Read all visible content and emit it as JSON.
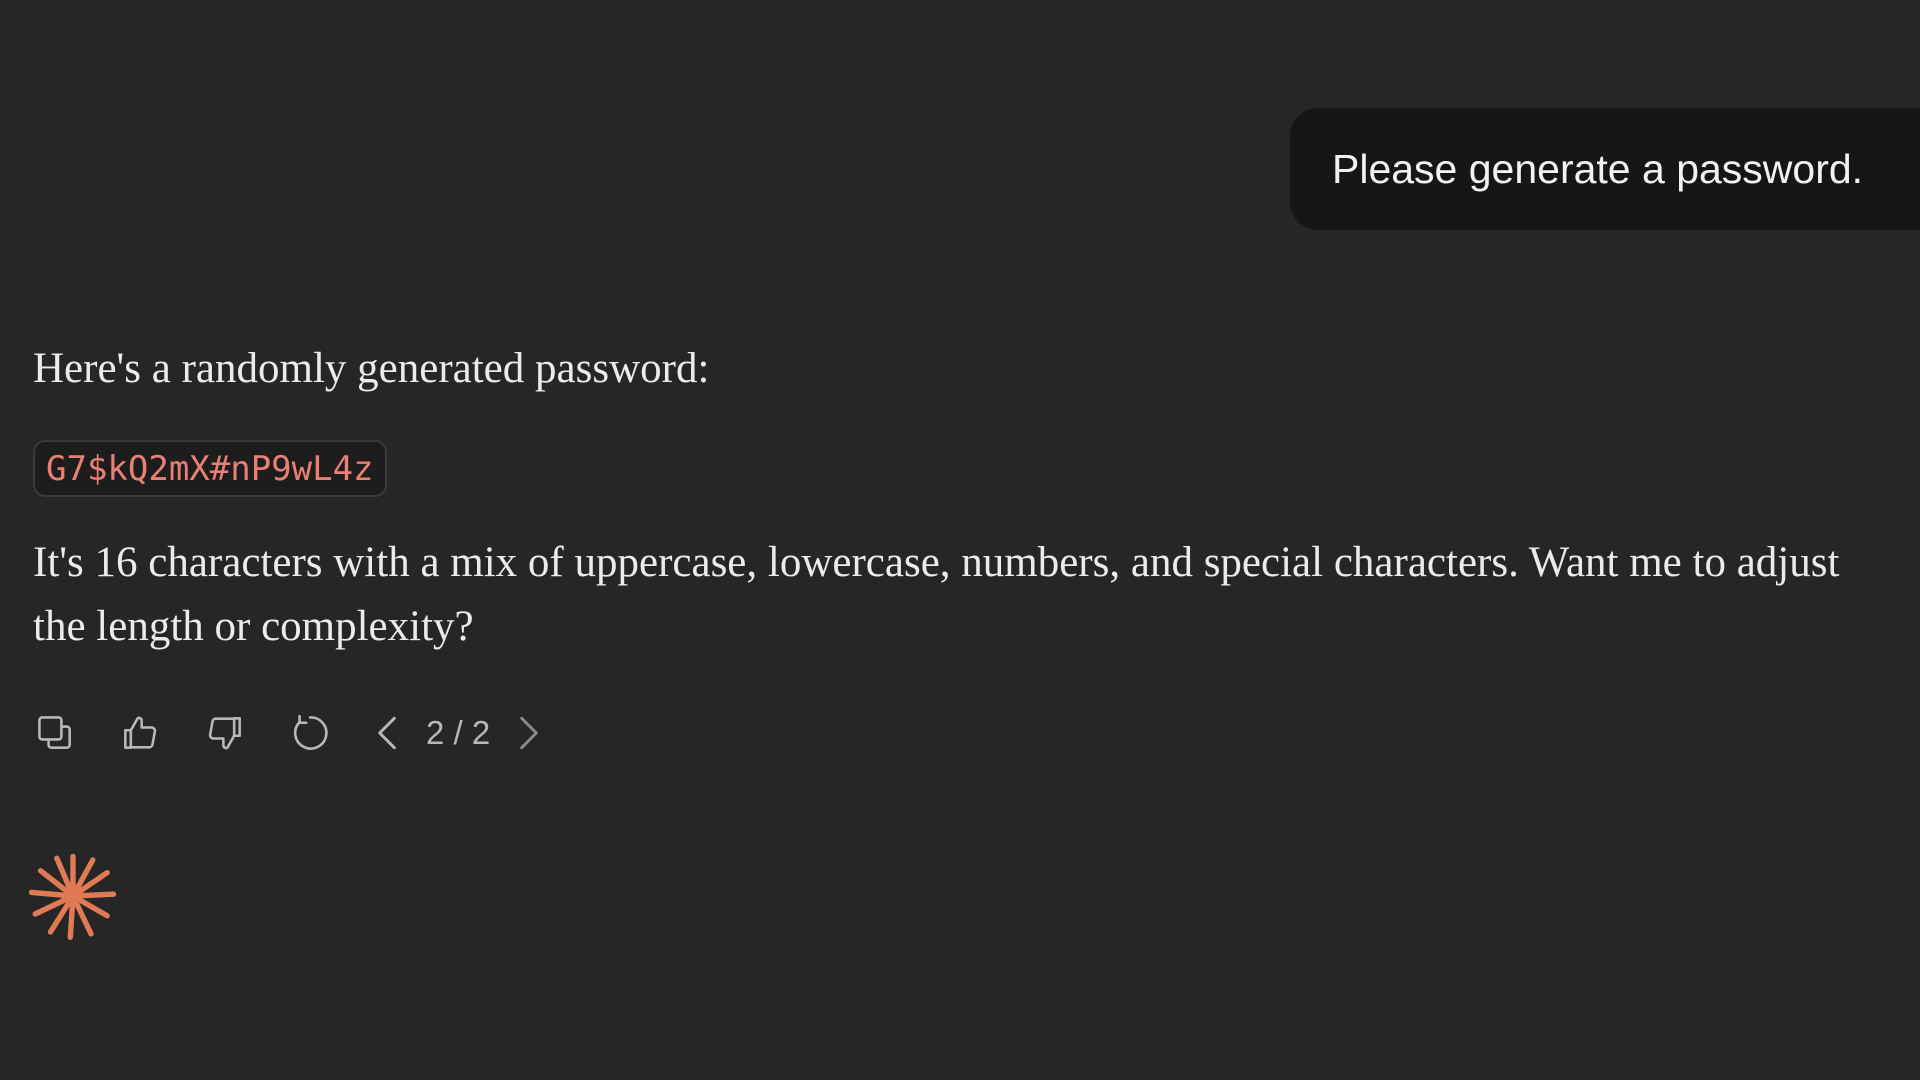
{
  "user_message": {
    "text": "Please generate a password."
  },
  "assistant_message": {
    "intro": "Here's a randomly generated password:",
    "code": "G7$kQ2mX#nP9wL4z",
    "body": "It's 16 characters with a mix of uppercase, lowercase, numbers, and special characters. Want me to adjust the length or complexity?"
  },
  "actions": {
    "icons": [
      "copy-icon",
      "thumbs-up-icon",
      "thumbs-down-icon",
      "retry-icon",
      "chevron-left-icon",
      "chevron-right-icon"
    ],
    "version_counter": "2 / 2"
  },
  "colors": {
    "background": "#262626",
    "user_bubble": "#161616",
    "code_text": "#ea7f74",
    "accent_spark": "#e07a55"
  }
}
